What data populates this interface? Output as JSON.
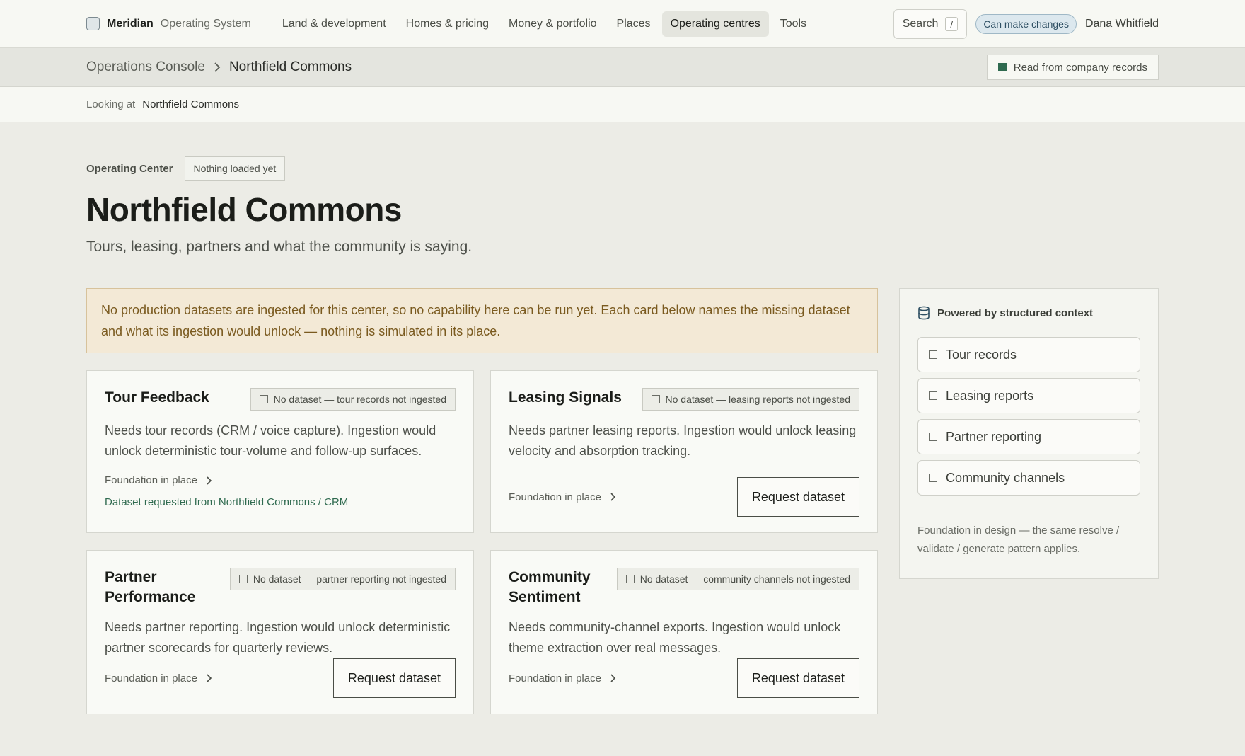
{
  "brand": {
    "name": "Meridian",
    "sub": "Operating System"
  },
  "nav": [
    {
      "label": "Land & development"
    },
    {
      "label": "Homes & pricing"
    },
    {
      "label": "Money & portfolio"
    },
    {
      "label": "Places"
    },
    {
      "label": "Operating centres",
      "active": true
    },
    {
      "label": "Tools"
    }
  ],
  "search": {
    "label": "Search",
    "shortcut": "/"
  },
  "permission_badge": "Can make changes",
  "user": {
    "name": "Dana Whitfield"
  },
  "breadcrumb": {
    "root": "Operations Console",
    "current": "Northfield Commons"
  },
  "source_pill": "Read from company records",
  "context": {
    "label": "Looking at",
    "value": "Northfield Commons"
  },
  "header": {
    "eyebrow": "Operating Center",
    "status": "Nothing loaded yet",
    "title": "Northfield Commons",
    "subtitle": "Tours, leasing, partners and what the community is saying."
  },
  "notice": "No production datasets are ingested for this center, so no capability here can be run yet. Each card below names the missing dataset and what its ingestion would unlock — nothing is simulated in its place.",
  "cards": [
    {
      "title": "Tour Feedback",
      "chip": "No dataset — tour records not ingested",
      "desc": "Needs tour records (CRM / voice capture). Ingestion would unlock deterministic tour-volume and follow-up surfaces.",
      "foundation": "Foundation in place",
      "requested": "Dataset requested from Northfield Commons / CRM"
    },
    {
      "title": "Leasing Signals",
      "chip": "No dataset — leasing reports not ingested",
      "desc": "Needs partner leasing reports. Ingestion would unlock leasing velocity and absorption tracking.",
      "foundation": "Foundation in place",
      "button": "Request dataset"
    },
    {
      "title": "Partner Performance",
      "chip": "No dataset — partner reporting not ingested",
      "desc": "Needs partner reporting. Ingestion would unlock deterministic partner scorecards for quarterly reviews.",
      "foundation": "Foundation in place",
      "button": "Request dataset"
    },
    {
      "title": "Community Sentiment",
      "chip": "No dataset — community channels not ingested",
      "desc": "Needs community-channel exports. Ingestion would unlock theme extraction over real messages.",
      "foundation": "Foundation in place",
      "button": "Request dataset"
    }
  ],
  "side": {
    "title": "Powered by structured context",
    "items": [
      "Tour records",
      "Leasing reports",
      "Partner reporting",
      "Community channels"
    ],
    "note": "Foundation in design — the same resolve / validate / generate pattern applies."
  },
  "colors": {
    "accent_green": "#2f6a4f",
    "notice_bg": "#f3e9d6",
    "notice_text": "#7a5a1f",
    "badge_blue": "#2e4f63"
  }
}
